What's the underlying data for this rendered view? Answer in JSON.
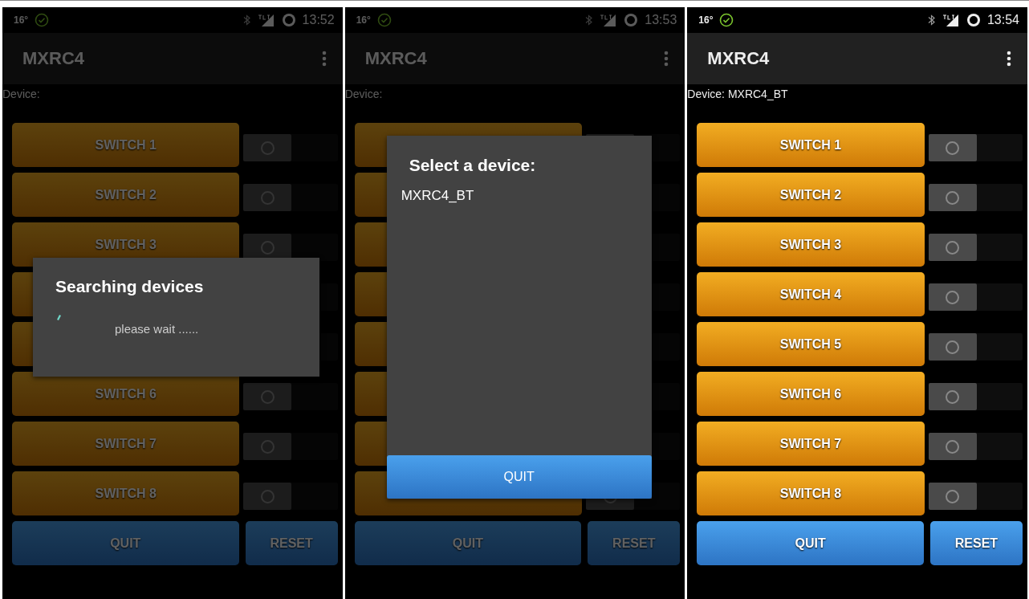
{
  "screens": [
    {
      "status_bar": {
        "temperature": "16°",
        "time": "13:52"
      },
      "app_bar": {
        "title": "MXRC4"
      },
      "device_label": "Device:",
      "dimmed": true,
      "switches": [
        {
          "label": "SWITCH 1",
          "checked": false
        },
        {
          "label": "SWITCH 2",
          "checked": false
        },
        {
          "label": "SWITCH 3",
          "checked": false
        },
        {
          "checked": false
        },
        {
          "checked": false
        },
        {
          "label": "SWITCH 6",
          "checked": false
        },
        {
          "label": "SWITCH 7",
          "checked": false
        },
        {
          "label": "SWITCH 8",
          "checked": false
        }
      ],
      "buttons": [
        {
          "label": "QUIT"
        },
        {
          "label": "RESET"
        }
      ],
      "dialog": {
        "kind": "progress",
        "title": "Searching devices",
        "message": "please wait ......"
      }
    },
    {
      "status_bar": {
        "temperature": "16°",
        "time": "13:53"
      },
      "app_bar": {
        "title": "MXRC4"
      },
      "device_label": "Device:",
      "dimmed": true,
      "switches": [
        {
          "checked": false
        },
        {
          "checked": false
        },
        {
          "checked": false
        },
        {
          "checked": false
        },
        {
          "checked": false
        },
        {
          "checked": false
        },
        {
          "checked": false
        },
        {
          "checked": false
        }
      ],
      "buttons": [
        {
          "label": "QUIT"
        },
        {
          "label": "RESET"
        }
      ],
      "dialog": {
        "kind": "list",
        "title": "Select a device:",
        "items": [
          "MXRC4_BT"
        ],
        "button": "QUIT"
      }
    },
    {
      "status_bar": {
        "temperature": "16°",
        "time": "13:54"
      },
      "app_bar": {
        "title": "MXRC4"
      },
      "device_label": "Device: MXRC4_BT",
      "dimmed": false,
      "switches": [
        {
          "label": "SWITCH 1",
          "checked": false
        },
        {
          "label": "SWITCH 2",
          "checked": false
        },
        {
          "label": "SWITCH 3",
          "checked": false
        },
        {
          "label": "SWITCH 4",
          "checked": false
        },
        {
          "label": "SWITCH 5",
          "checked": false
        },
        {
          "label": "SWITCH 6",
          "checked": false
        },
        {
          "label": "SWITCH 7",
          "checked": false
        },
        {
          "label": "SWITCH 8",
          "checked": false
        }
      ],
      "buttons": [
        {
          "label": "QUIT"
        },
        {
          "label": "RESET"
        }
      ]
    }
  ]
}
